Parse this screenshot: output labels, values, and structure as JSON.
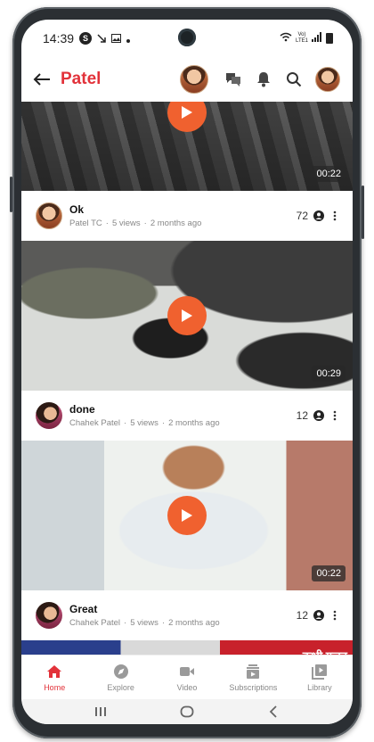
{
  "status_bar": {
    "time": "14:39",
    "badge": "S",
    "network": "Vo) LTE1"
  },
  "header": {
    "title": "Patel",
    "accent": "#e2323a",
    "icons": [
      "back-arrow-icon",
      "chat-icon",
      "bell-icon",
      "search-icon"
    ]
  },
  "videos": [
    {
      "title": "Ok",
      "channel": "Patel TC",
      "views": "5 views",
      "age": "2 months ago",
      "duration": "00:22",
      "count": "72"
    },
    {
      "title": "done",
      "channel": "Chahek Patel",
      "views": "5 views",
      "age": "2 months ago",
      "duration": "00:29",
      "count": "12"
    },
    {
      "title": "Great",
      "channel": "Chahek Patel",
      "views": "5 views",
      "age": "2 months ago",
      "duration": "00:22",
      "count": "12"
    },
    {
      "overlay_text": "कभी गजन"
    }
  ],
  "bottom_nav": [
    {
      "label": "Home",
      "icon": "home-icon",
      "active": true
    },
    {
      "label": "Explore",
      "icon": "compass-icon",
      "active": false
    },
    {
      "label": "Video",
      "icon": "video-camera-icon",
      "active": false
    },
    {
      "label": "Subscriptions",
      "icon": "subscriptions-icon",
      "active": false
    },
    {
      "label": "Library",
      "icon": "library-icon",
      "active": false
    }
  ],
  "play_color": "#f0612f"
}
